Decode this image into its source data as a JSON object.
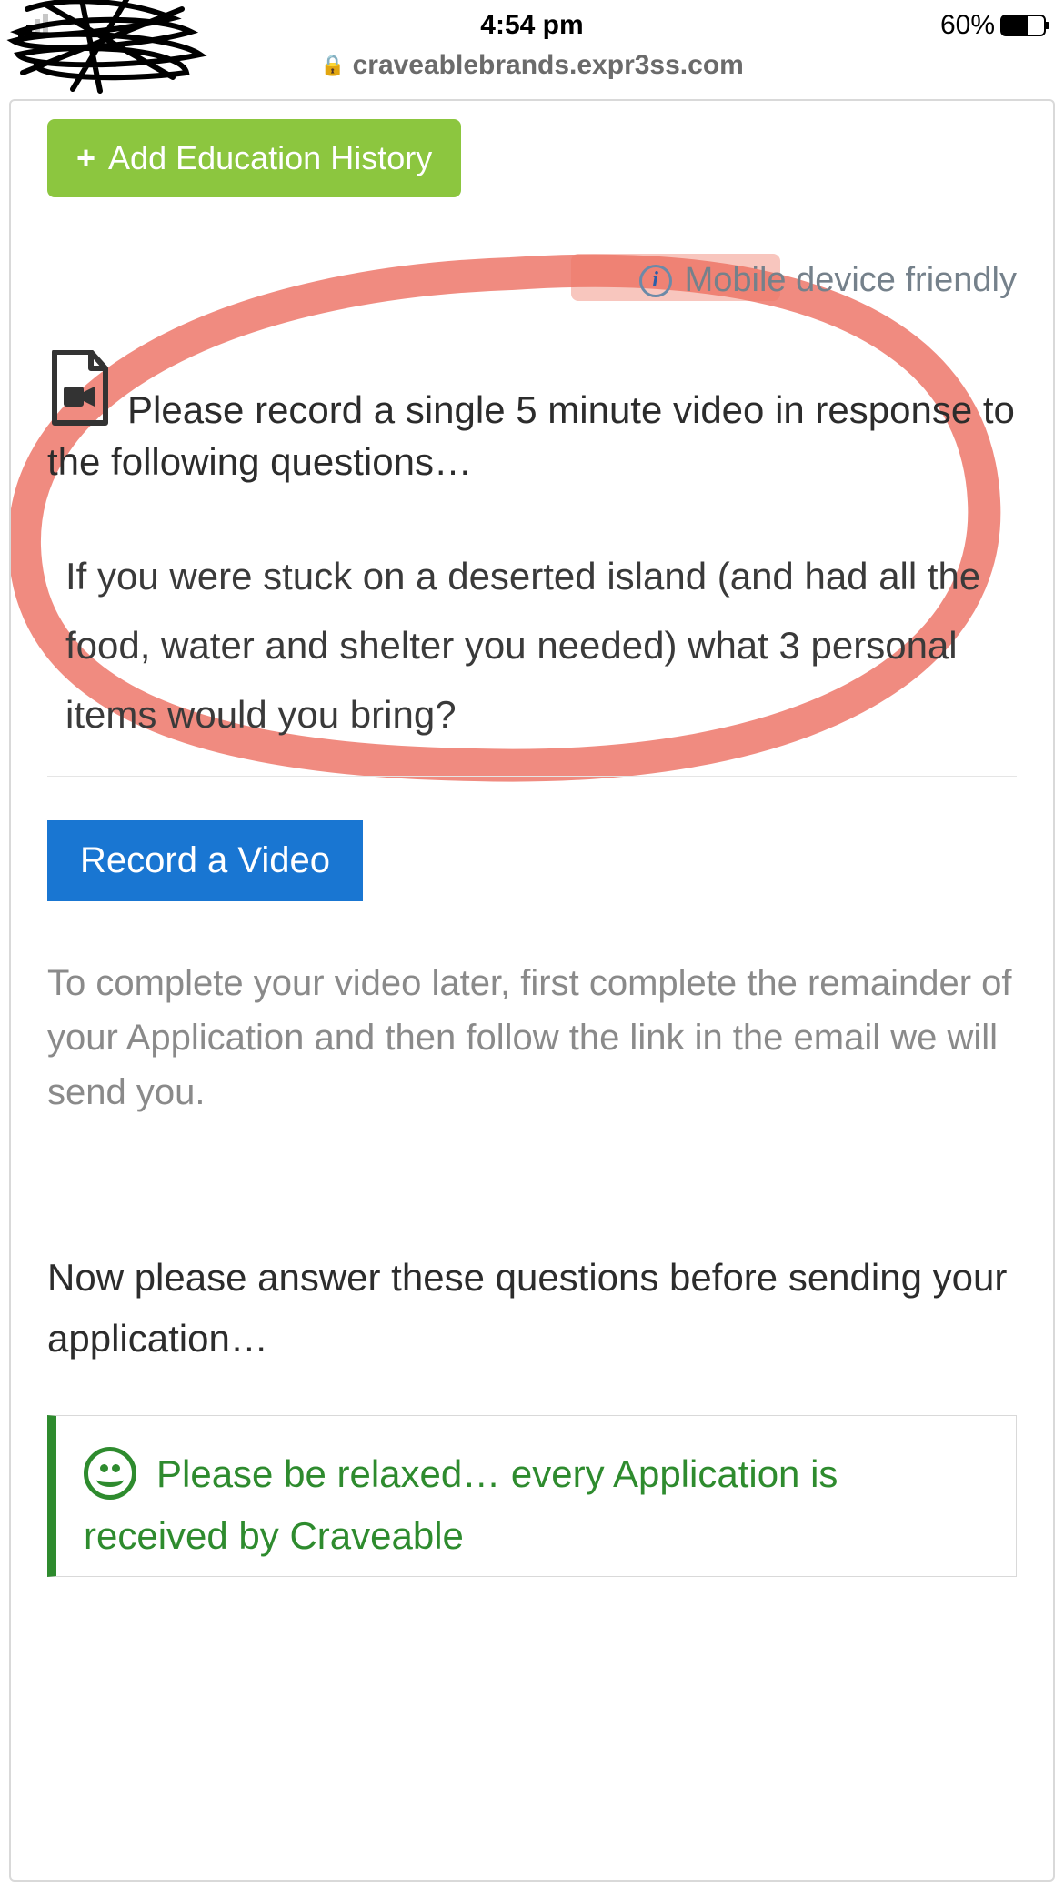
{
  "status": {
    "time": "4:54 pm",
    "battery_pct": "60%"
  },
  "url": "craveablebrands.expr3ss.com",
  "buttons": {
    "add_education": "Add Education History",
    "record_video": "Record a Video"
  },
  "labels": {
    "mobile_friendly": "Mobile device friendly"
  },
  "video": {
    "heading": "Please record a single 5 minute video in response to the following questions…",
    "question": "If you were stuck on a deserted island (and had all the food, water and shelter you needed) what 3 personal items would you bring?",
    "hint": "To complete your video later, first complete the remainder of your Application and then follow the link in the email we will send you."
  },
  "next_section": {
    "heading": "Now please answer these questions before sending your application…",
    "panel_text": "Please be relaxed… every Application is received by Craveable"
  }
}
